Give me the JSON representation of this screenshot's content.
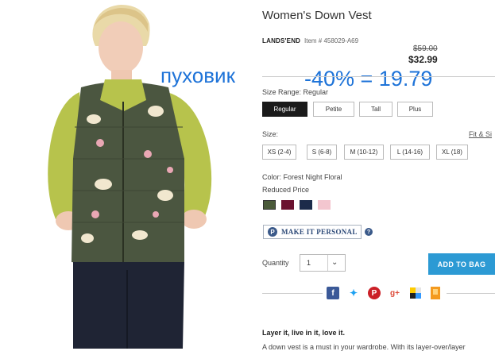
{
  "product": {
    "title": "Women's Down Vest",
    "brand": "LANDS'END",
    "item_number": "Item # 458029-A69",
    "original_price": "$59.00",
    "sale_price": "$32.99"
  },
  "overlay": {
    "russian_label": "пуховик",
    "discount_text": "-40% = 19.79"
  },
  "size_range": {
    "label": "Size Range: Regular",
    "options": [
      "Regular",
      "Petite",
      "Tall",
      "Plus"
    ],
    "selected": "Regular"
  },
  "size": {
    "label": "Size:",
    "fit_link": "Fit & Si",
    "options": [
      "XS (2-4)",
      "S (6-8)",
      "M (10-12)",
      "L (14-16)",
      "XL (18)"
    ]
  },
  "color": {
    "label": "Color: Forest Night Floral",
    "reduced_label": "Reduced Price",
    "swatches": [
      "forest-night-floral",
      "burgundy",
      "navy-floral",
      "pink-floral"
    ],
    "swatch_colors": [
      "#4a5a3a",
      "#6b1230",
      "#1c2b4a",
      "#f3c6cf"
    ]
  },
  "personalize": {
    "icon_letter": "P",
    "label": "MAKE IT PERSONAL",
    "help_icon": "?"
  },
  "quantity": {
    "label": "Quantity",
    "value": "1"
  },
  "cart": {
    "add_label": "ADD TO BAG"
  },
  "social": {
    "icons": [
      "facebook-icon",
      "twitter-icon",
      "pinterest-icon",
      "google-plus-icon",
      "delicious-icon",
      "bookmark-icon"
    ],
    "glyphs": [
      "f",
      "t",
      "P",
      "g+",
      "",
      ""
    ],
    "colors": [
      "#3b5998",
      "#1da1f2",
      "#cb2027",
      "#dd4b39",
      "#3399ff",
      "#f49a1f"
    ]
  },
  "description": {
    "heading": "Layer it, live in it, love it.",
    "body": "A down vest is a must in your wardrobe. With its layer-over/layer"
  }
}
